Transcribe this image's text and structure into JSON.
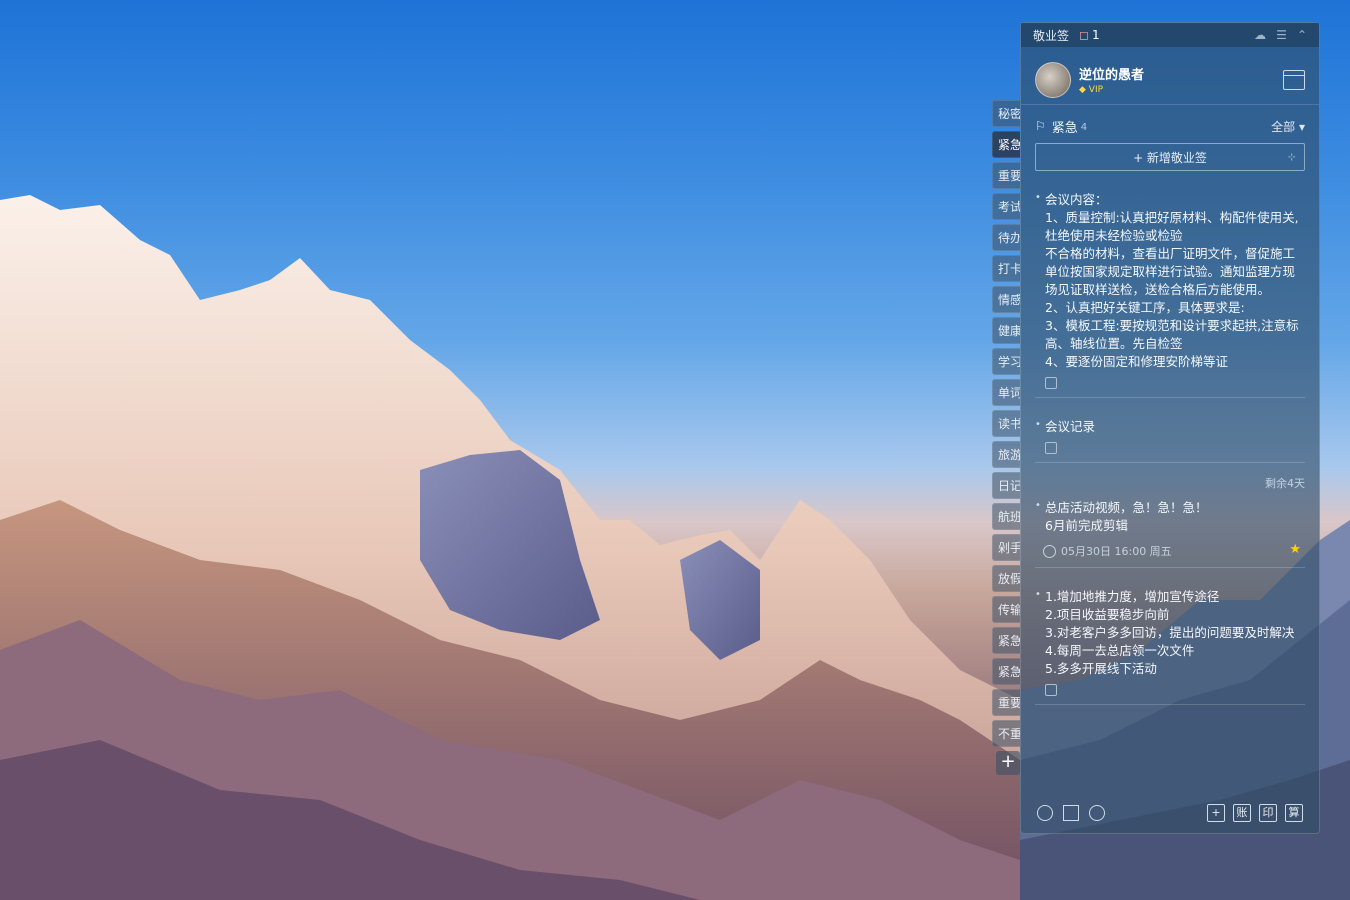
{
  "app": {
    "title": "敬业签",
    "notification_count": "1"
  },
  "user": {
    "name": "逆位的愚者",
    "badge": "VIP"
  },
  "category": {
    "name": "紧急",
    "count": "4",
    "filter": "全部"
  },
  "add_button": {
    "label": "+ 新增敬业签"
  },
  "tabs": [
    "秘密",
    "紧急",
    "重要",
    "考试",
    "待办",
    "打卡",
    "情感",
    "健康",
    "学习",
    "单词",
    "读书",
    "旅游",
    "日记",
    "航班",
    "剁手",
    "放假",
    "传输",
    "紧急",
    "紧急",
    "重要",
    "不重"
  ],
  "notes": [
    {
      "lines": [
        "会议内容：",
        "1、质量控制:认真把好原材料、构配件使用关,杜绝使用未经检验或检验",
        "不合格的材料，查看出厂证明文件，督促施工单位按国家规定取样进行试验。通知监理方现场见证取样送检，送检合格后方能使用。",
        "2、认真把好关键工序，具体要求是:",
        "3、模板工程:要按规范和设计要求起拱,注意标高、轴线位置。先自检签",
        "4、要逐份固定和修理安阶梯等证"
      ]
    },
    {
      "lines": [
        "会议记录"
      ]
    },
    {
      "remain": "剩余4天",
      "lines": [
        "总店活动视频，急！急！急！",
        "6月前完成剪辑"
      ],
      "time": "05月30日 16:00 周五"
    },
    {
      "lines": [
        "1.增加地推力度，增加宣传途径",
        "2.项目收益要稳步向前",
        "3.对老客户多多回访，提出的问题要及时解决",
        "4.每周一去总店领一次文件",
        "5.多多开展线下活动"
      ]
    }
  ],
  "footer": {
    "buttons": [
      "+",
      "账",
      "印",
      "算"
    ]
  },
  "colors": {
    "accent": "#ffd000",
    "panel": "#304c66"
  }
}
